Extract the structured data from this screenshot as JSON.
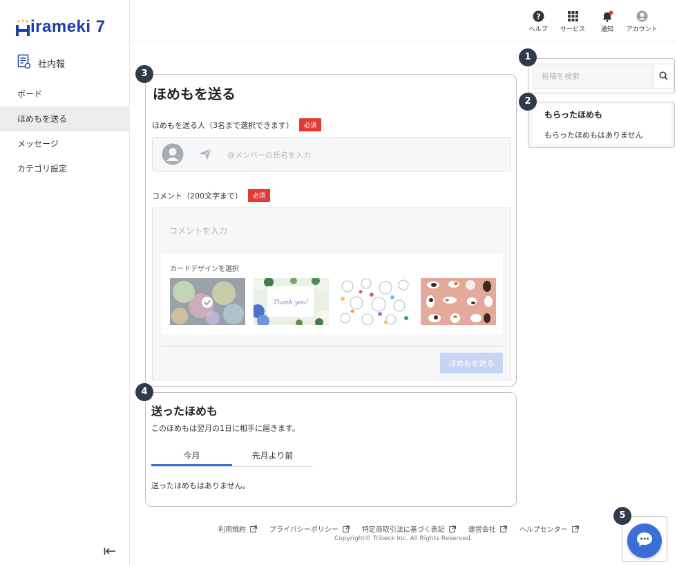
{
  "app": {
    "logo_text": "irameki 7"
  },
  "sidebar": {
    "section_title": "社内報",
    "items": [
      {
        "label": "ボード"
      },
      {
        "label": "ほめもを送る"
      },
      {
        "label": "メッセージ"
      },
      {
        "label": "カテゴリ設定"
      }
    ],
    "collapse_glyph": "|←"
  },
  "header": {
    "help": "ヘルプ",
    "services": "サービス",
    "notifications": "通知",
    "account": "アカウント"
  },
  "badges": [
    "1",
    "2",
    "3",
    "4",
    "5"
  ],
  "send_panel": {
    "title": "ほめもを送る",
    "recipients_label": "ほめもを送る人（3名まで選択できます）",
    "required": "必須",
    "member_placeholder": "@メンバーの氏名を入力",
    "comment_label": "コメント（200文字まで）",
    "comment_placeholder": "コメントを入力",
    "card_design_label": "カードデザインを選択",
    "card_thankyou_text": "Thank you!",
    "submit": "ほめもを送る"
  },
  "sent_panel": {
    "title": "送ったほめも",
    "note": "このほめもは翌月の1日に相手に届きます。",
    "tabs": [
      "今月",
      "先月より前"
    ],
    "empty": "送ったほめもはありません。"
  },
  "search": {
    "placeholder": "投稿を検索"
  },
  "received": {
    "title": "もらったほめも",
    "empty": "もらったほめもはありません"
  },
  "footer": {
    "links": [
      "利用規約",
      "プライバシーポリシー",
      "特定商取引法に基づく表記",
      "運営会社",
      "ヘルプセンター"
    ],
    "copyright": "Copyright© Tribeck Inc. All Rights Reserved."
  },
  "colors": {
    "brand": "#1a3fa8",
    "accent": "#3b6fd8",
    "required": "#e53935",
    "badge": "#2f3a4a"
  }
}
